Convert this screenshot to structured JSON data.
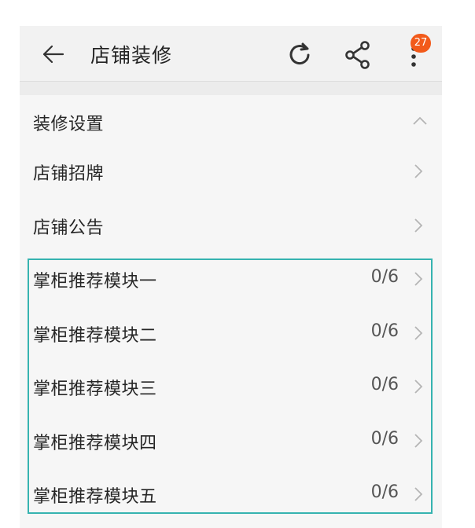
{
  "header": {
    "title": "店铺装修",
    "badge_count": "27"
  },
  "section": {
    "title": "装修设置"
  },
  "rows": [
    {
      "label": "店铺招牌",
      "count": ""
    },
    {
      "label": "店铺公告",
      "count": ""
    },
    {
      "label": "掌柜推荐模块一",
      "count": "0/6"
    },
    {
      "label": "掌柜推荐模块二",
      "count": "0/6"
    },
    {
      "label": "掌柜推荐模块三",
      "count": "0/6"
    },
    {
      "label": "掌柜推荐模块四",
      "count": "0/6"
    },
    {
      "label": "掌柜推荐模块五",
      "count": "0/6"
    }
  ],
  "icons": {
    "back": "back-arrow-icon",
    "refresh": "refresh-icon",
    "share": "share-icon",
    "more": "more-vertical-icon",
    "collapse": "chevron-up-icon",
    "row_arrow": "chevron-right-icon"
  },
  "colors": {
    "highlight": "#36b3b0",
    "badge": "#f25a1a"
  }
}
